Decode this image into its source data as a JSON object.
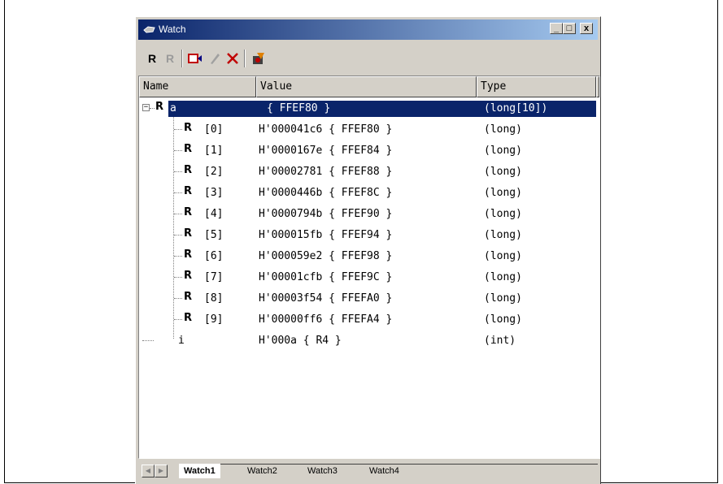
{
  "window": {
    "title": "Watch",
    "controls": {
      "minimize": "_",
      "maximize": "□",
      "close": "x"
    }
  },
  "toolbar": {
    "items": [
      "R",
      "R",
      "add-watch",
      "edit",
      "delete",
      "refresh"
    ]
  },
  "columns": {
    "name": "Name",
    "value": "Value",
    "type": "Type"
  },
  "rows": [
    {
      "name": "a",
      "value": "{ FFEF80 }",
      "type": "(long[10])"
    },
    {
      "name": "[0]",
      "value": "H'000041c6 { FFEF80 }",
      "type": "(long)"
    },
    {
      "name": "[1]",
      "value": "H'0000167e { FFEF84 }",
      "type": "(long)"
    },
    {
      "name": "[2]",
      "value": "H'00002781 { FFEF88 }",
      "type": "(long)"
    },
    {
      "name": "[3]",
      "value": "H'0000446b { FFEF8C }",
      "type": "(long)"
    },
    {
      "name": "[4]",
      "value": "H'0000794b { FFEF90 }",
      "type": "(long)"
    },
    {
      "name": "[5]",
      "value": "H'000015fb { FFEF94 }",
      "type": "(long)"
    },
    {
      "name": "[6]",
      "value": "H'000059e2 { FFEF98 }",
      "type": "(long)"
    },
    {
      "name": "[7]",
      "value": "H'00001cfb { FFEF9C }",
      "type": "(long)"
    },
    {
      "name": "[8]",
      "value": "H'00003f54 { FFEFA0 }",
      "type": "(long)"
    },
    {
      "name": "[9]",
      "value": "H'00000ff6 { FFEFA4 }",
      "type": "(long)"
    },
    {
      "name": "i",
      "value": "H'000a { R4 }",
      "type": "(int)"
    }
  ],
  "tabs": [
    "Watch1",
    "Watch2",
    "Watch3",
    "Watch4"
  ],
  "colors": {
    "title_start": "#0a246a",
    "title_end": "#a6caf0",
    "selection": "#0a246a",
    "face": "#d4d0c8"
  }
}
